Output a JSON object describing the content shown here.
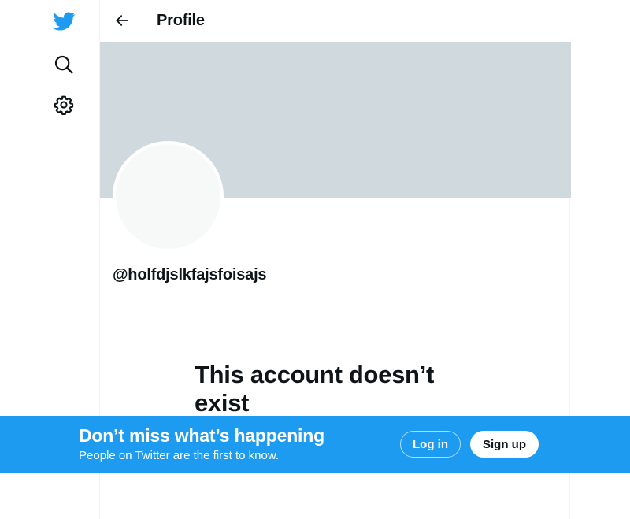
{
  "colors": {
    "brand": "#1d9bf0",
    "banner": "#cfd9de",
    "avatar": "#f7f9f9",
    "text": "#0f1419"
  },
  "nav": {
    "items": [
      {
        "icon": "twitter-bird-icon"
      },
      {
        "icon": "search-icon"
      },
      {
        "icon": "gear-icon"
      }
    ]
  },
  "header": {
    "back_icon": "back-arrow-icon",
    "title": "Profile"
  },
  "profile": {
    "handle": "@holfdjslkfajsfoisajs",
    "empty_state_title": "This account doesn’t exist"
  },
  "bottom_bar": {
    "title": "Don’t miss what’s happening",
    "subtitle": "People on Twitter are the first to know.",
    "login_label": "Log in",
    "signup_label": "Sign up"
  }
}
